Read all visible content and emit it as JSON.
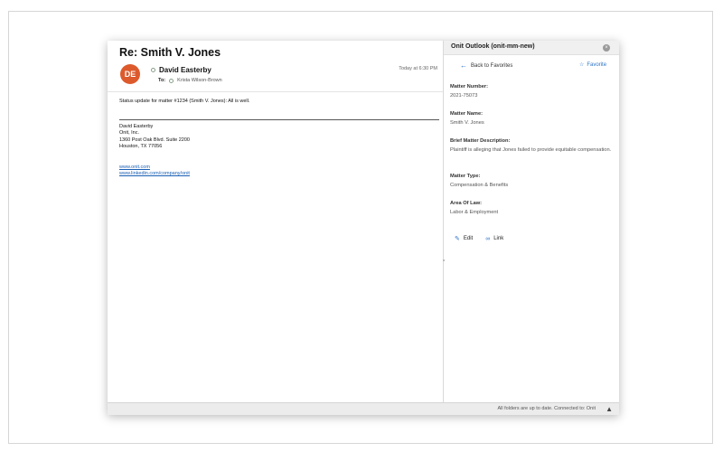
{
  "email": {
    "subject": "Re: Smith V. Jones",
    "avatar_initials": "DE",
    "sender_name": "David Easterby",
    "to_label": "To:",
    "recipient": "Krista Wilson-Brown",
    "timestamp": "Today at 6:30 PM",
    "body": "Status update for matter #1234 (Smith V. Jones):  All is well.",
    "signature": {
      "name": "David Easterby",
      "company": "Onit, Inc.",
      "address1": "1360 Post Oak Blvd. Suite 2200",
      "address2": "Houston, TX 77056"
    },
    "links": [
      "www.onit.com",
      "www.linkedin.com/company/onit"
    ]
  },
  "panel": {
    "title": "Onit Outlook (onit-mm-new)",
    "back_label": "Back to Favorites",
    "favorite_label": "Favorite",
    "fields": [
      {
        "label": "Matter Number:",
        "value": "2021-75073"
      },
      {
        "label": "Matter Name:",
        "value": "Smith V. Jones"
      },
      {
        "label": "Brief Matter Description:",
        "value": "Plaintiff is alleging that Jones failed to provide equitable compensation."
      },
      {
        "label": "Matter Type:",
        "value": "Compensation & Benefits"
      },
      {
        "label": "Area Of Law:",
        "value": "Labor & Employment"
      }
    ],
    "edit_label": "Edit",
    "link_label": "Link"
  },
  "status": {
    "text": "All folders are up to date.    Connected to: Onit"
  },
  "colors": {
    "avatar": "#dd5a2d",
    "accent": "#2f74c7",
    "link": "#1a5fb4"
  },
  "icons": [
    "close-icon",
    "back-arrow-icon",
    "star-icon",
    "pencil-icon",
    "link-icon",
    "warning-icon"
  ]
}
